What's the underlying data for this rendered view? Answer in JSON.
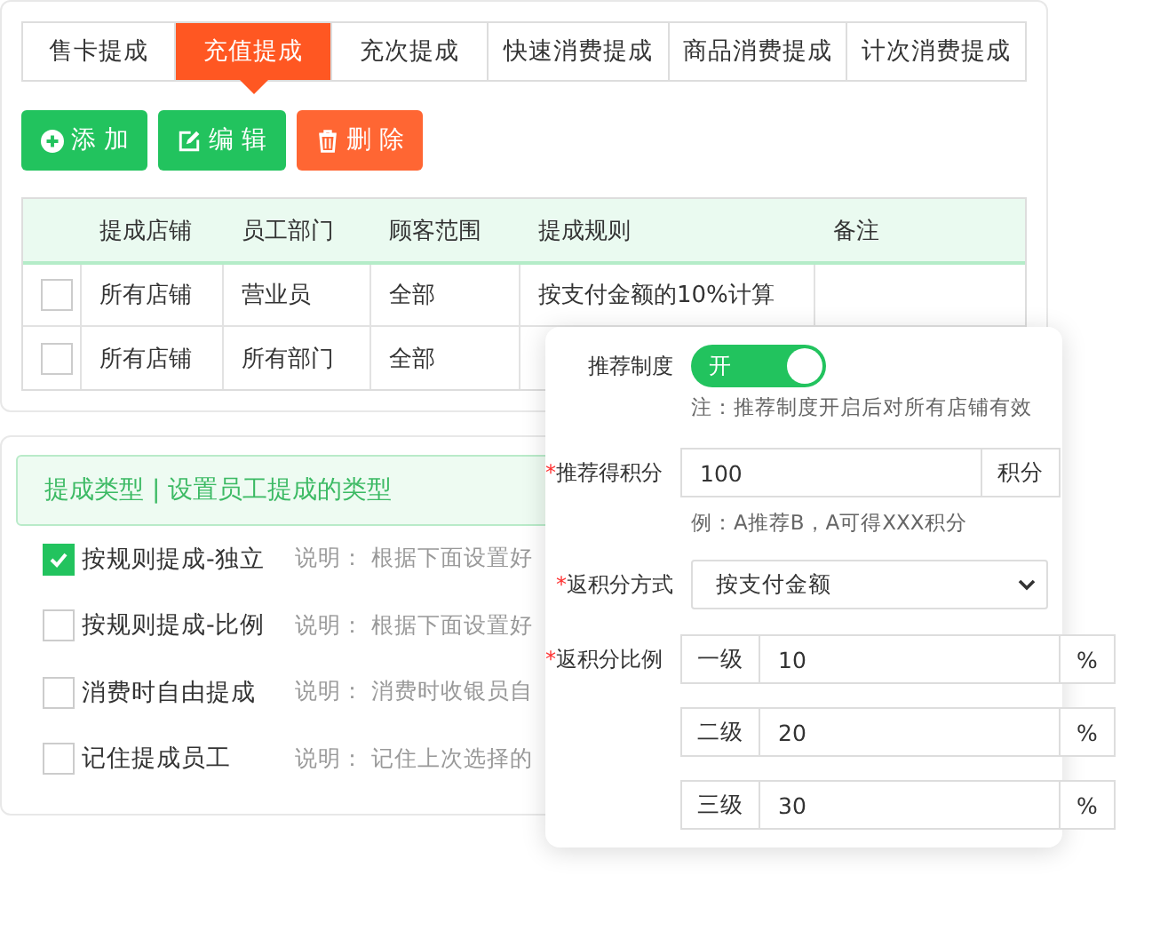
{
  "tabs": [
    {
      "label": "售卡提成",
      "selected": false
    },
    {
      "label": "充值提成",
      "selected": true
    },
    {
      "label": "充次提成",
      "selected": false
    },
    {
      "label": "快速消费提成",
      "selected": false
    },
    {
      "label": "商品消费提成",
      "selected": false
    },
    {
      "label": "计次消费提成",
      "selected": false
    }
  ],
  "actions": [
    {
      "kind": "add",
      "label": "添 加"
    },
    {
      "kind": "edit",
      "label": "编 辑"
    },
    {
      "kind": "delete",
      "label": "删 除"
    }
  ],
  "table": {
    "columns": [
      "提成店铺",
      "员工部门",
      "顾客范围",
      "提成规则",
      "备注"
    ],
    "rows": [
      {
        "checked": false,
        "cells": [
          "所有店铺",
          "营业员",
          "全部",
          "按支付金额的10%计算",
          ""
        ]
      },
      {
        "checked": false,
        "cells": [
          "所有店铺",
          "所有部门",
          "全部",
          "",
          ""
        ]
      }
    ]
  },
  "types": {
    "title": "提成类型 | 设置员工提成的类型",
    "items": [
      {
        "label": "按规则提成-独立",
        "checked": true,
        "note": "说明： 根据下面设置好"
      },
      {
        "label": "按规则提成-比例",
        "checked": false,
        "note": "说明： 根据下面设置好"
      },
      {
        "label": "消费时自由提成",
        "checked": false,
        "note": "说明： 消费时收银员自"
      },
      {
        "label": "记住提成员工",
        "checked": false,
        "note": "说明： 记住上次选择的"
      }
    ]
  },
  "referral": {
    "toggle": {
      "label": "推荐制度",
      "on": true,
      "text": "开"
    },
    "toggle_note": "注：推荐制度开启后对所有店铺有效",
    "points": {
      "mark": "*",
      "label": "推荐得积分",
      "value": "100",
      "unit": "积分"
    },
    "points_note": "例：A推荐B，A可得XXX积分",
    "method": {
      "mark": "*",
      "label": "返积分方式",
      "value": "按支付金额"
    },
    "ratio": {
      "mark": "*",
      "label": "返积分比例",
      "levels": [
        {
          "name": "一级",
          "value": "10",
          "unit": "%"
        },
        {
          "name": "二级",
          "value": "20",
          "unit": "%"
        },
        {
          "name": "三级",
          "value": "30",
          "unit": "%"
        }
      ]
    }
  }
}
